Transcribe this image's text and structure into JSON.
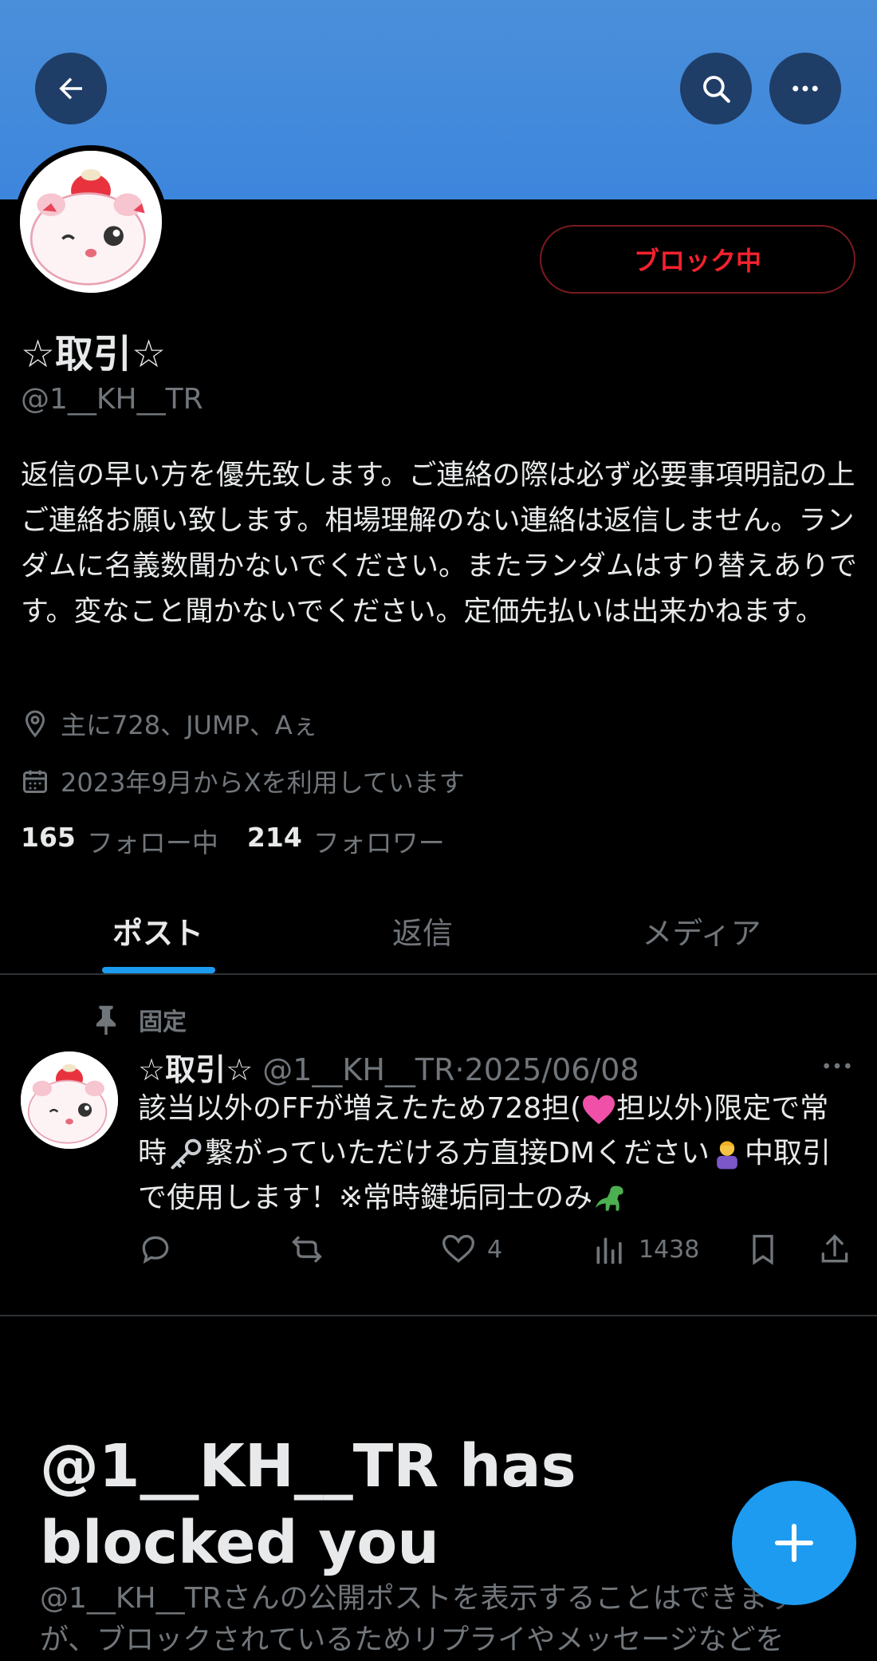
{
  "header": {
    "back_icon": "arrow-left-icon",
    "search_icon": "search-icon",
    "more_icon": "more-horizontal-icon",
    "banner_color": "#4a8fd9"
  },
  "profile": {
    "block_button_label": "ブロック中",
    "display_name": "☆取引☆",
    "handle": "@1__KH__TR",
    "bio": "返信の早い方を優先致します。ご連絡の際は必ず必要事項明記の上ご連絡お願い致します。相場理解のない連絡は返信しません。ランダムに名義数聞かないでください。またランダムはすり替えありです。変なこと聞かないでください。定価先払いは出来かねます。",
    "location": "主に728、JUMP、Aぇ",
    "joined": "2023年9月からXを利用しています",
    "following_count": "165",
    "following_label": "フォロー中",
    "followers_count": "214",
    "followers_label": "フォロワー"
  },
  "tabs": [
    {
      "label": "ポスト",
      "active": true
    },
    {
      "label": "返信",
      "active": false
    },
    {
      "label": "メディア",
      "active": false
    }
  ],
  "pinned_post": {
    "pinned_label": "固定",
    "author_name": "☆取引☆",
    "author_handle": "@1__KH__TR",
    "separator": "·",
    "date": "2025/06/08",
    "text_part1": "該当以外のFFが増えたため728担(",
    "text_part2": "担以外)限定で常時",
    "text_part3": "繋がっていただける方直接DMください",
    "text_part4": "中取引で使用します！※常時鍵垢同士のみ",
    "likes": "4",
    "views": "1438"
  },
  "blocked": {
    "title": "@1__KH__TR has blocked you",
    "description": "@1__KH__TRさんの公開ポストを表示することはできますが、ブロックされているためリプライやメッセージなどを"
  },
  "colors": {
    "accent": "#1d9bf0",
    "block_red": "#f4212e"
  }
}
